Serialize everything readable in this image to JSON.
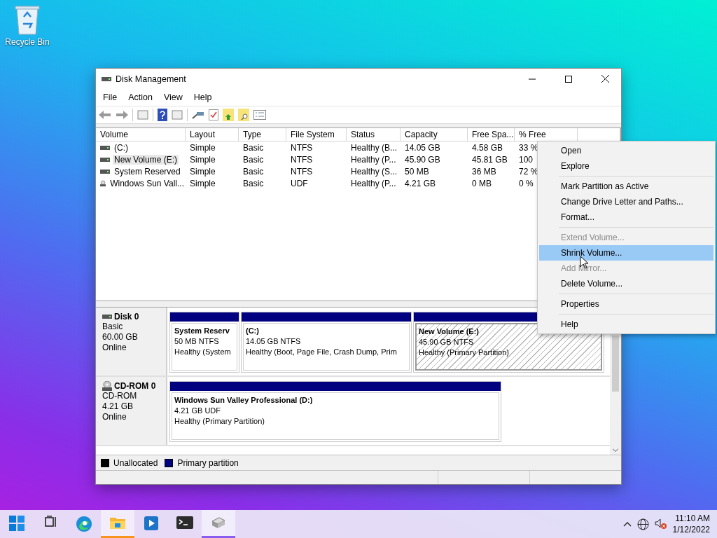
{
  "desktop": {
    "icons": [
      {
        "label": "Recycle Bin"
      }
    ]
  },
  "window": {
    "title": "Disk Management",
    "menu": [
      "File",
      "Action",
      "View",
      "Help"
    ],
    "volume_table": {
      "columns": [
        "Volume",
        "Layout",
        "Type",
        "File System",
        "Status",
        "Capacity",
        "Free Spa...",
        "% Free"
      ],
      "rows": [
        {
          "kind": "disk",
          "selected": false,
          "cells": [
            "(C:)",
            "Simple",
            "Basic",
            "NTFS",
            "Healthy (B...",
            "14.05 GB",
            "4.58 GB",
            "33 %"
          ]
        },
        {
          "kind": "disk",
          "selected": true,
          "cells": [
            "New Volume (E:)",
            "Simple",
            "Basic",
            "NTFS",
            "Healthy (P...",
            "45.90 GB",
            "45.81 GB",
            "100"
          ]
        },
        {
          "kind": "disk",
          "selected": false,
          "cells": [
            "System Reserved",
            "Simple",
            "Basic",
            "NTFS",
            "Healthy (S...",
            "50 MB",
            "36 MB",
            "72 %"
          ]
        },
        {
          "kind": "cd",
          "selected": false,
          "cells": [
            "Windows Sun Vall...",
            "Simple",
            "Basic",
            "UDF",
            "Healthy (P...",
            "4.21 GB",
            "0 MB",
            "0 %"
          ]
        }
      ]
    },
    "disks": [
      {
        "kind": "disk",
        "name": "Disk 0",
        "details": [
          "Basic",
          "60.00 GB",
          "Online"
        ],
        "partitions": [
          {
            "name": "System Reserv",
            "size": "50 MB NTFS",
            "status": "Healthy (System",
            "selected": false
          },
          {
            "name": "(C:)",
            "size": "14.05 GB NTFS",
            "status": "Healthy (Boot, Page File, Crash Dump, Prim",
            "selected": false
          },
          {
            "name": "New Volume (E:)",
            "size": "45.90 GB NTFS",
            "status": "Healthy (Primary Partition)",
            "selected": true
          }
        ]
      },
      {
        "kind": "cd",
        "name": "CD-ROM 0",
        "details": [
          "CD-ROM",
          "4.21 GB",
          "Online"
        ],
        "partitions": [
          {
            "name": "Windows Sun Valley Professional (D:)",
            "size": "4.21 GB UDF",
            "status": "Healthy (Primary Partition)",
            "selected": false
          }
        ]
      }
    ],
    "legend": [
      {
        "label": "Unallocated",
        "color": "#000000"
      },
      {
        "label": "Primary partition",
        "color": "#000080"
      }
    ]
  },
  "context_menu": {
    "groups": [
      [
        {
          "label": "Open",
          "disabled": false,
          "selected": false
        },
        {
          "label": "Explore",
          "disabled": false,
          "selected": false
        }
      ],
      [
        {
          "label": "Mark Partition as Active",
          "disabled": false,
          "selected": false
        },
        {
          "label": "Change Drive Letter and Paths...",
          "disabled": false,
          "selected": false
        },
        {
          "label": "Format...",
          "disabled": false,
          "selected": false
        }
      ],
      [
        {
          "label": "Extend Volume...",
          "disabled": true,
          "selected": false
        },
        {
          "label": "Shrink Volume...",
          "disabled": false,
          "selected": true
        },
        {
          "label": "Add Mirror...",
          "disabled": true,
          "selected": false
        },
        {
          "label": "Delete Volume...",
          "disabled": false,
          "selected": false
        }
      ],
      [
        {
          "label": "Properties",
          "disabled": false,
          "selected": false
        }
      ],
      [
        {
          "label": "Help",
          "disabled": false,
          "selected": false
        }
      ]
    ]
  },
  "taskbar": {
    "apps": [
      {
        "kind": "start",
        "open": false
      },
      {
        "kind": "taskview",
        "open": false
      },
      {
        "kind": "edge",
        "open": false
      },
      {
        "kind": "explorer",
        "open": true,
        "color": "#f7941d"
      },
      {
        "kind": "media",
        "open": false
      },
      {
        "kind": "terminal",
        "open": false
      },
      {
        "kind": "diskmgmt",
        "open": true,
        "color": "#8a5cf0"
      }
    ],
    "clock": {
      "time": "11:10 AM",
      "date": "1/12/2022"
    }
  }
}
